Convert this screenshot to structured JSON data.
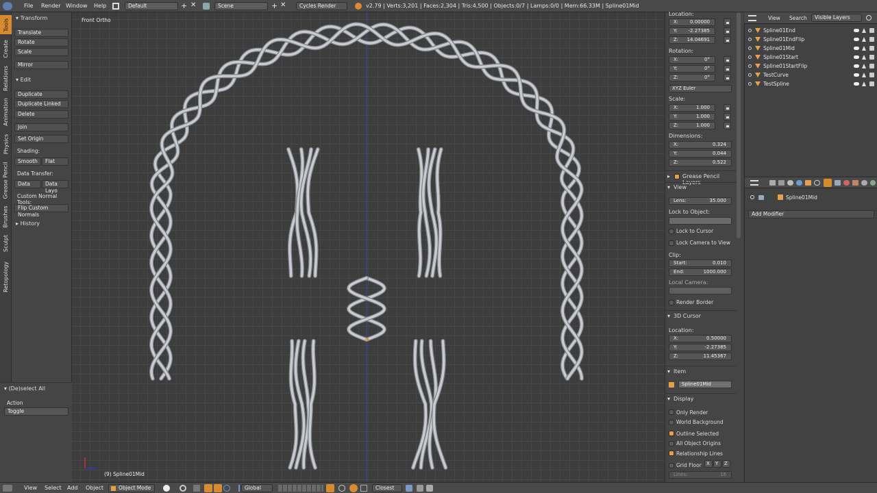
{
  "topbar": {
    "menus": [
      "File",
      "Render",
      "Window",
      "Help"
    ],
    "layout": "Default",
    "scene": "Scene",
    "engine": "Cycles Render",
    "stats": "v2.79 | Verts:3,201 | Faces:2,304 | Tris:4,500 | Objects:0/7 | Lamps:0/0 | Mem:66.33M | Spline01Mid"
  },
  "tabs": [
    "Tools",
    "Create",
    "Relations",
    "Animation",
    "Physics",
    "Grease Pencil",
    "Brushes",
    "Sculpt",
    "Retopology"
  ],
  "toolshelf": {
    "transform_header": "Transform",
    "translate": "Translate",
    "rotate": "Rotate",
    "scale": "Scale",
    "mirror": "Mirror",
    "edit_header": "Edit",
    "duplicate": "Duplicate",
    "duplicate_linked": "Duplicate Linked",
    "delete": "Delete",
    "join": "Join",
    "set_origin": "Set Origin",
    "shading_label": "Shading:",
    "smooth": "Smooth",
    "flat": "Flat",
    "data_transfer_label": "Data Transfer:",
    "data": "Data",
    "data_layo": "Data Layo",
    "custom_normal_label": "Custom Normal Tools:",
    "flip_normals": "Flip Custom Normals",
    "history_header": "History",
    "operator_header": "(De)select All",
    "action_label": "Action",
    "action_value": "Toggle"
  },
  "viewport": {
    "view_label": "Front Ortho",
    "object_label": "(9) Spline01Mid"
  },
  "npanel": {
    "location_label": "Location:",
    "loc": [
      {
        "k": "X:",
        "v": "0.00000"
      },
      {
        "k": "Y:",
        "v": "-2.27385"
      },
      {
        "k": "Z:",
        "v": "14.04691"
      }
    ],
    "rotation_label": "Rotation:",
    "rot": [
      {
        "k": "X:",
        "v": "0°"
      },
      {
        "k": "Y:",
        "v": "0°"
      },
      {
        "k": "Z:",
        "v": "0°"
      }
    ],
    "rot_mode": "XYZ Euler",
    "scale_label": "Scale:",
    "scale": [
      {
        "k": "X:",
        "v": "1.000"
      },
      {
        "k": "Y:",
        "v": "1.000"
      },
      {
        "k": "Z:",
        "v": "1.000"
      }
    ],
    "dimensions_label": "Dimensions:",
    "dims": [
      {
        "k": "X:",
        "v": "0.324"
      },
      {
        "k": "Y:",
        "v": "0.044"
      },
      {
        "k": "Z:",
        "v": "0.522"
      }
    ],
    "grease_pencil_layers": "Grease Pencil Layers",
    "view_header": "View",
    "lens_label": "Lens:",
    "lens_value": "35.000",
    "lock_to_object": "Lock to Object:",
    "lock_to_cursor": "Lock to Cursor",
    "lock_camera": "Lock Camera to View",
    "clip_label": "Clip:",
    "clip_start_k": "Start:",
    "clip_start_v": "0.010",
    "clip_end_k": "End:",
    "clip_end_v": "1000.000",
    "local_camera": "Local Camera:",
    "render_border": "Render Border",
    "cursor_header": "3D Cursor",
    "cursor_location": "Location:",
    "cursor": [
      {
        "k": "X:",
        "v": "0.50000"
      },
      {
        "k": "Y:",
        "v": "-2.27385"
      },
      {
        "k": "Z:",
        "v": "11.45367"
      }
    ],
    "item_header": "Item",
    "item_name": "Spline01Mid",
    "display_header": "Display",
    "only_render": "Only Render",
    "world_background": "World Background",
    "outline_selected": "Outline Selected",
    "all_object_origins": "All Object Origins",
    "relationship_lines": "Relationship Lines",
    "grid_floor": "Grid Floor",
    "axes": [
      "X",
      "Y",
      "Z"
    ],
    "lines_label": "Lines:",
    "lines_value": "16"
  },
  "outliner": {
    "view": "View",
    "search": "Search",
    "filter": "Visible Layers",
    "items": [
      "Spline01End",
      "Spline01EndFlip",
      "Spline01Mid",
      "Spline01Start",
      "Spline01StartFlip",
      "TestCurve",
      "TestSpline"
    ]
  },
  "properties": {
    "object": "Spline01Mid",
    "add_modifier": "Add Modifier"
  },
  "bottombar": {
    "view": "View",
    "select": "Select",
    "add": "Add",
    "object": "Object",
    "mode": "Object Mode",
    "orientation": "Global",
    "snap": "Closest"
  },
  "colors": {
    "accent": "#d88a2e",
    "checkbox_on": "#e8a048",
    "rope": "#c8ccd0"
  }
}
